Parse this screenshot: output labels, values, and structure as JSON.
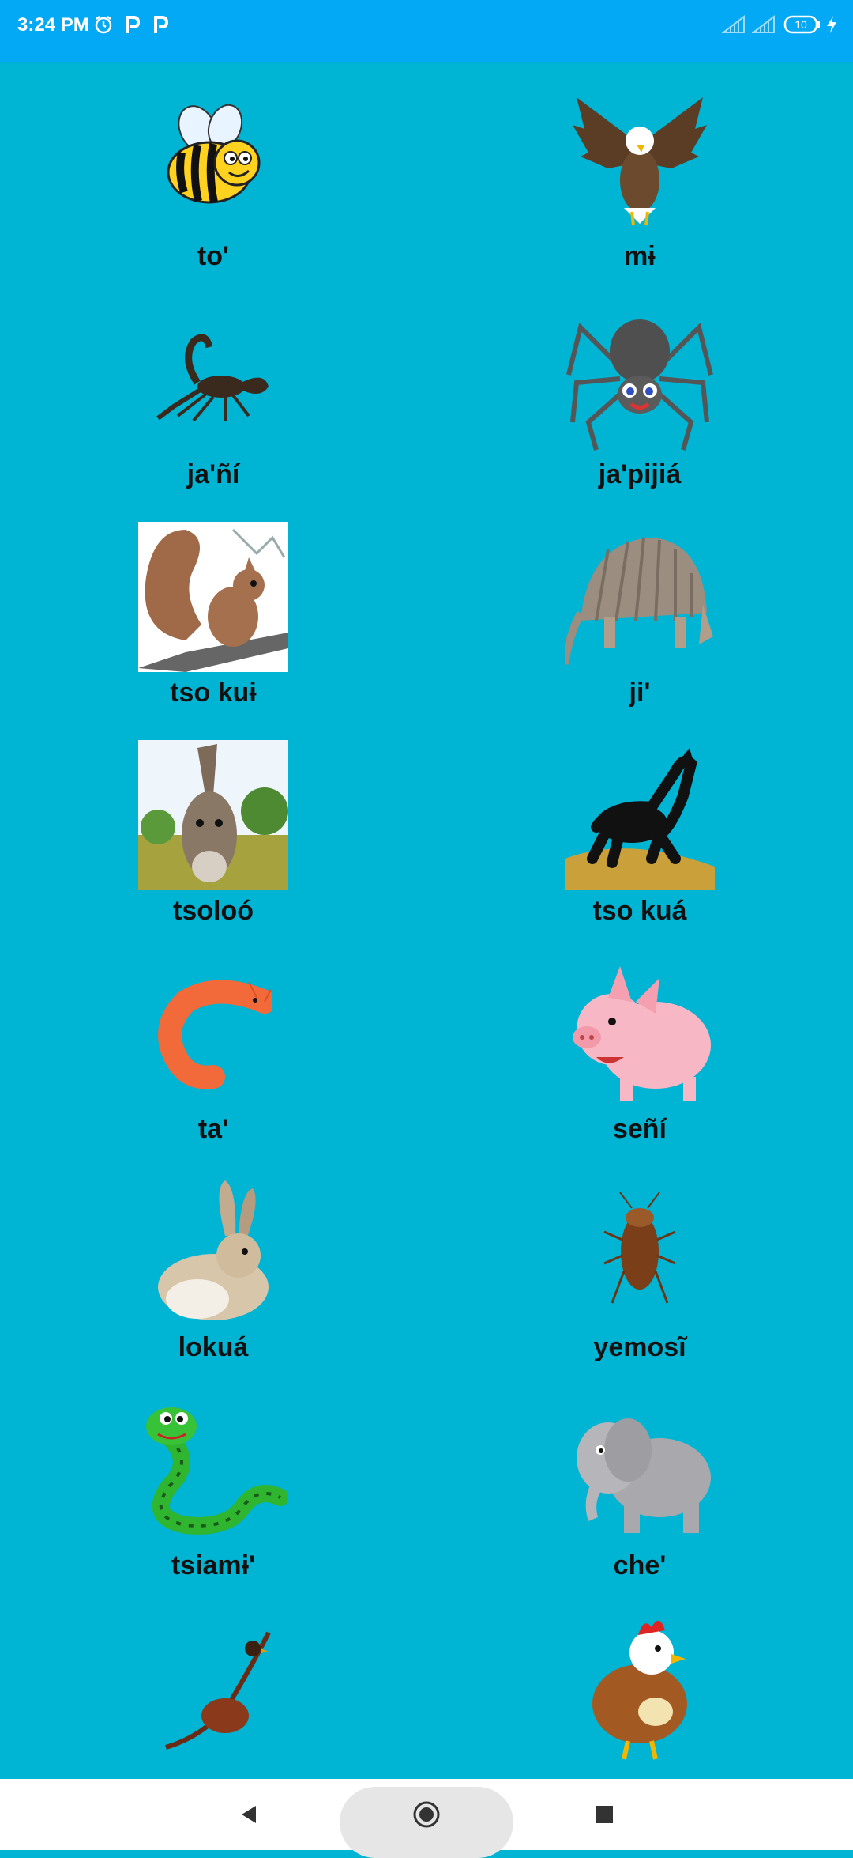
{
  "status_bar": {
    "time": "3:24 PM",
    "battery": "10",
    "icons": [
      "alarm-icon",
      "p-app-icon",
      "p-app-icon",
      "signal-icon",
      "signal-icon",
      "battery-icon",
      "charging-icon"
    ]
  },
  "colors": {
    "background": "#00B4D4",
    "status_bar": "#03A9F4",
    "label_text": "#111111",
    "nav_bar": "#FFFFFF"
  },
  "animals": [
    {
      "label": "to'",
      "icon": "bee-icon"
    },
    {
      "label": "mɨ",
      "icon": "eagle-icon"
    },
    {
      "label": "ja'ñí",
      "icon": "scorpion-icon"
    },
    {
      "label": "ja'pijiá",
      "icon": "spider-icon"
    },
    {
      "label": "tso kuɨ",
      "icon": "squirrel-icon"
    },
    {
      "label": "ji'",
      "icon": "armadillo-icon"
    },
    {
      "label": "tsoloó",
      "icon": "donkey-icon"
    },
    {
      "label": "tso kuá",
      "icon": "horse-icon"
    },
    {
      "label": "ta'",
      "icon": "shrimp-icon"
    },
    {
      "label": "señí",
      "icon": "pig-icon"
    },
    {
      "label": "lokuá",
      "icon": "rabbit-icon"
    },
    {
      "label": "yemosĩ",
      "icon": "cockroach-icon"
    },
    {
      "label": "tsiamɨ'",
      "icon": "snake-icon"
    },
    {
      "label": "che'",
      "icon": "elephant-icon"
    },
    {
      "label": "",
      "icon": "pheasant-icon"
    },
    {
      "label": "",
      "icon": "hen-icon"
    }
  ],
  "nav": {
    "back": "back-icon",
    "home": "home-icon",
    "recents": "recents-icon"
  }
}
